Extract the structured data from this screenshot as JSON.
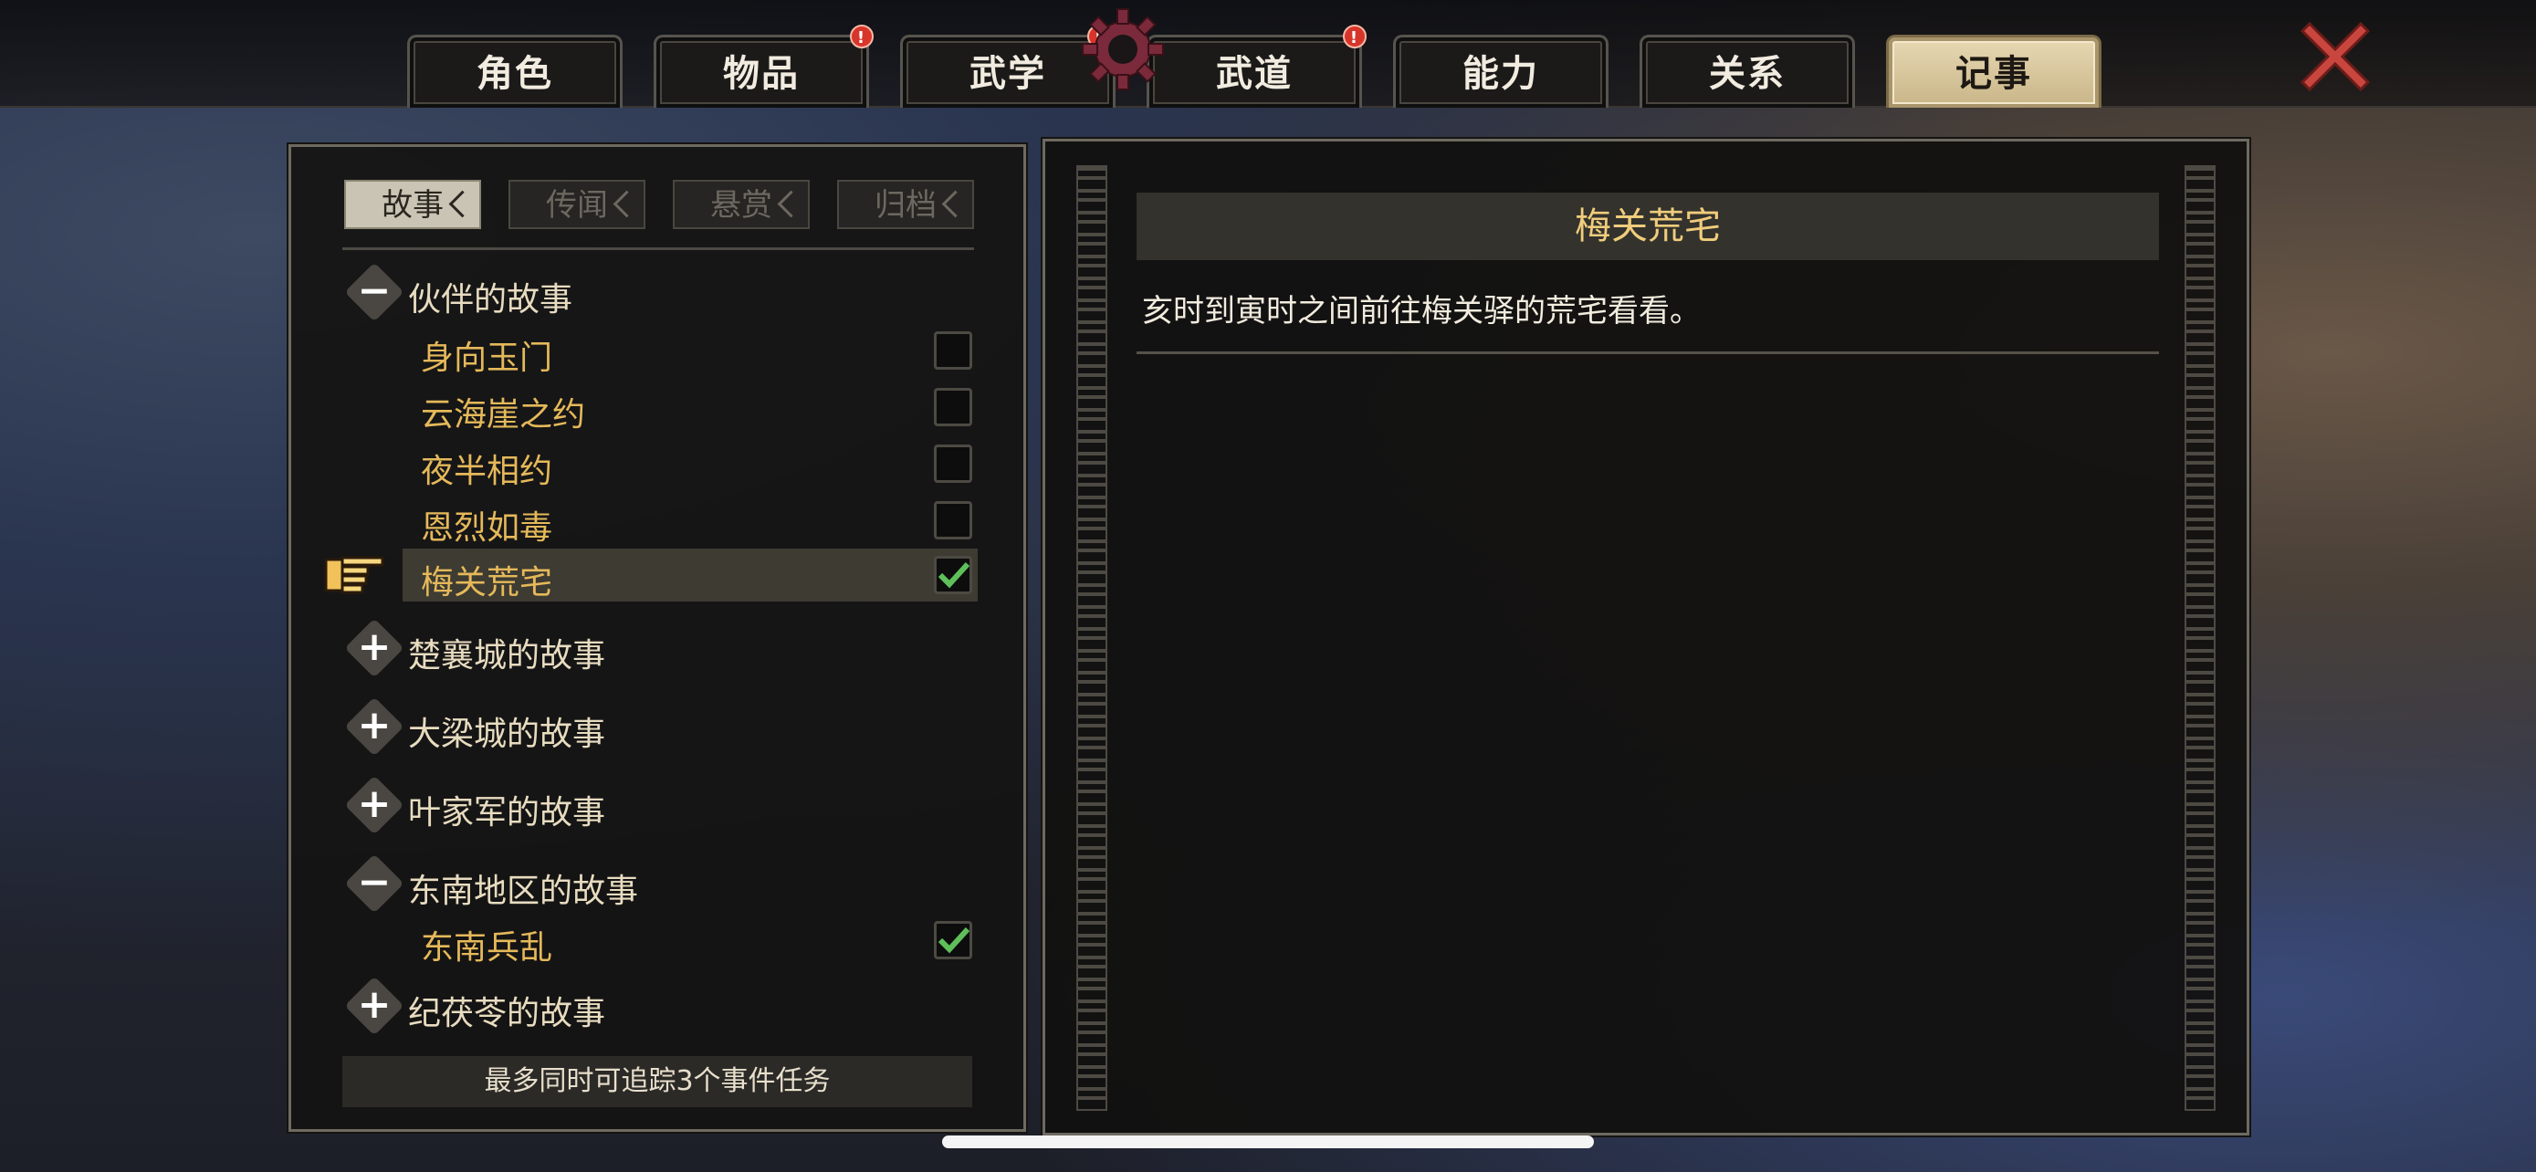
{
  "top_tabs": [
    {
      "label": "角色",
      "badge": ""
    },
    {
      "label": "物品",
      "badge": "!"
    },
    {
      "label": "武学",
      "badge": "!"
    },
    {
      "label": "武道",
      "badge": "!"
    },
    {
      "label": "能力",
      "badge": ""
    },
    {
      "label": "关系",
      "badge": ""
    },
    {
      "label": "记事",
      "badge": "",
      "active": true
    }
  ],
  "sub_tabs": [
    "故事",
    "传闻",
    "悬赏",
    "归档"
  ],
  "story_tree": {
    "cat1": {
      "label": "伙伴的故事",
      "expanded": true
    },
    "cat1_items": [
      {
        "label": "身向玉门",
        "checked": false
      },
      {
        "label": "云海崖之约",
        "checked": false
      },
      {
        "label": "夜半相约",
        "checked": false
      },
      {
        "label": "恩烈如毒",
        "checked": false
      },
      {
        "label": "梅关荒宅",
        "checked": true,
        "selected": true
      }
    ],
    "cat2": {
      "label": "楚襄城的故事",
      "expanded": false
    },
    "cat3": {
      "label": "大梁城的故事",
      "expanded": false
    },
    "cat4": {
      "label": "叶家军的故事",
      "expanded": false
    },
    "cat5": {
      "label": "东南地区的故事",
      "expanded": true
    },
    "cat5_items": [
      {
        "label": "东南兵乱",
        "checked": true
      }
    ],
    "cat6": {
      "label": "纪茯苓的故事",
      "expanded": false
    }
  },
  "toggle_symbols": {
    "expanded": "−",
    "collapsed": "+"
  },
  "footer_note": "最多同时可追踪3个事件任务",
  "detail": {
    "title": "梅关荒宅",
    "description": "亥时到寅时之间前往梅关驿的荒宅看看。"
  },
  "colors": {
    "accent_gold": "#e5b95a",
    "check_green": "#5fc05a",
    "close_red": "#c9463f",
    "active_tab": "#d9c89e"
  }
}
